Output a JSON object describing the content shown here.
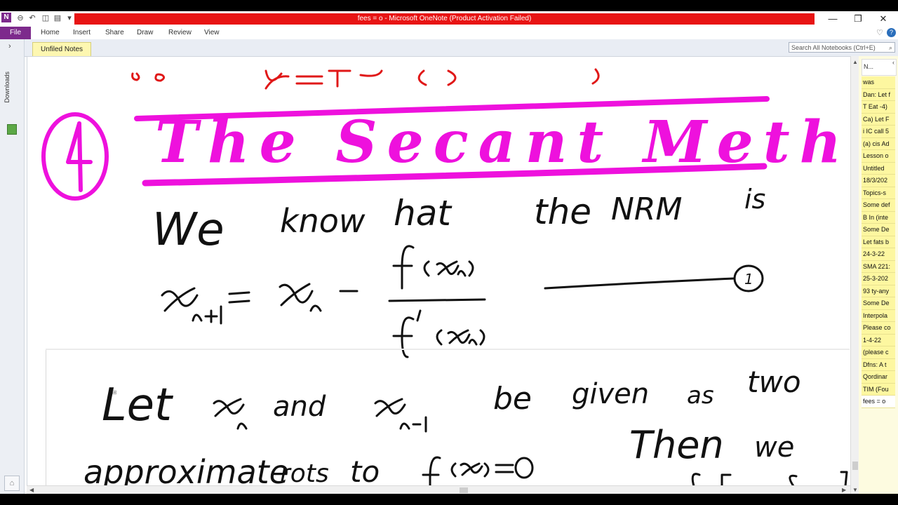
{
  "window": {
    "title": "fees = o  -  Microsoft OneNote (Product Activation Failed)",
    "app_icon": "N",
    "controls": {
      "minimize": "—",
      "restore": "❐",
      "close": "✕"
    }
  },
  "ribbon": {
    "file": "File",
    "tabs": [
      "Home",
      "Insert",
      "Share",
      "Draw",
      "Review",
      "View"
    ],
    "help": "?"
  },
  "left_panel": {
    "expand": "›",
    "label": "Downloads"
  },
  "section": {
    "tab": "Unfiled Notes"
  },
  "search": {
    "placeholder": "Search All Notebooks (Ctrl+E)"
  },
  "pages_panel": {
    "new_page": "N...",
    "items": [
      "was",
      "Dan: Let f",
      "T Eat -4)",
      "Ca) Let F",
      "i IC call 5",
      "(a) cis Ad",
      "Lesson o",
      "Untitled",
      "18/3/202",
      "Topics-s",
      "Some def",
      "B In (inte",
      "Some De",
      "Let fats b",
      "24-3-22",
      "SMA 221:",
      "25-3-202",
      "93 ty-any",
      "Some De",
      "Interpola",
      "Please co",
      "1-4-22",
      "(please c",
      "Dfns: A t",
      "Qordinar",
      "TIM (Fou",
      "fees = o"
    ],
    "selected_index": 26
  },
  "ink": {
    "heading_number": "4",
    "heading": "The Secant Method",
    "line1": [
      "We",
      "know",
      "hat",
      "the",
      "NRM",
      "is"
    ],
    "eq_label": "1",
    "line4": [
      "Let",
      "and",
      "be",
      "given",
      "as",
      "two"
    ],
    "line5": [
      "Then",
      "we"
    ],
    "line6": [
      "approximate",
      "rots",
      "to"
    ],
    "ink_color": "#111111",
    "heading_color": "#ee11dd",
    "top_ink_color": "#e01818"
  }
}
